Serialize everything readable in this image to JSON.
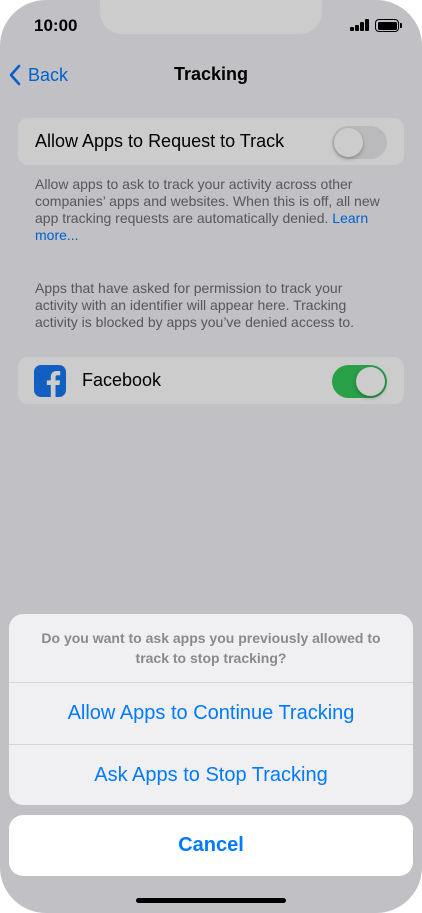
{
  "status_bar": {
    "time": "10:00"
  },
  "nav": {
    "back_label": "Back",
    "title": "Tracking"
  },
  "allow_request_cell": {
    "label": "Allow Apps to Request to Track",
    "toggle_on": false
  },
  "footnote_1": {
    "text": "Allow apps to ask to track your activity across other companies’ apps and websites. When this is off, all new app tracking requests are automatically denied.",
    "link": "Learn more..."
  },
  "footnote_2": {
    "text": "Apps that have asked for permission to track your activity with an identifier will appear here. Tracking activity is blocked by apps you’ve denied access to."
  },
  "apps": [
    {
      "name": "Facebook",
      "icon": "facebook-icon",
      "toggle_on": true
    }
  ],
  "action_sheet": {
    "message": "Do you want to ask apps you previously allowed to track to stop tracking?",
    "buttons": [
      "Allow Apps to Continue Tracking",
      "Ask Apps to Stop Tracking"
    ],
    "cancel": "Cancel"
  },
  "colors": {
    "accent": "#007aff",
    "toggle_on": "#34c759",
    "facebook": "#1877f2"
  }
}
